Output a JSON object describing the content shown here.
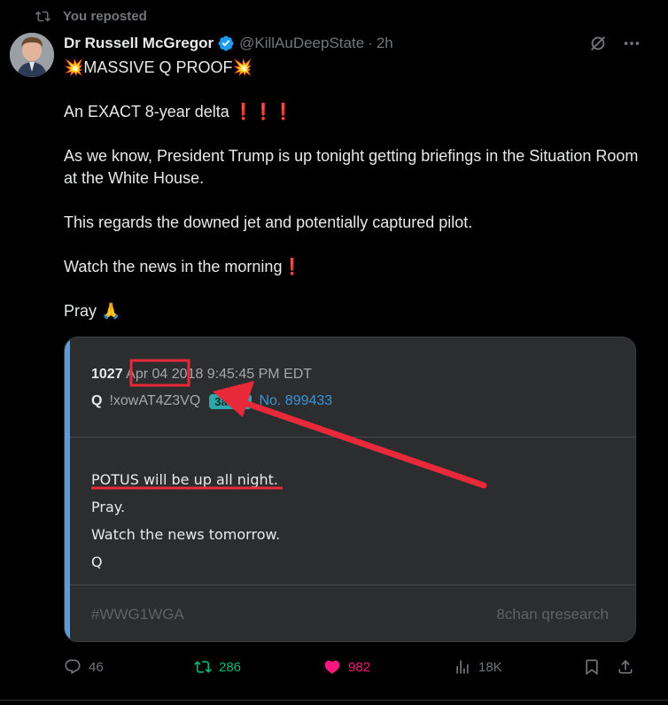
{
  "repost_label": "You reposted",
  "author": {
    "display_name": "Dr Russell McGregor",
    "handle": "@KillAuDeepState",
    "separator": "·",
    "time": "2h"
  },
  "tweet": {
    "headline_prefix": "💥",
    "headline": "MASSIVE Q PROOF",
    "headline_suffix": "💥",
    "line2": "An EXACT 8-year delta",
    "line2_marks": "❗❗❗",
    "line3": "As we know, President Trump is up tonight getting briefings in the Situation Room at the White House.",
    "line4": "This regards the downed jet and potentially captured pilot.",
    "line5": "Watch the news in the morning",
    "line5_mark": "❗",
    "line6": "Pray",
    "line6_emoji": "🙏"
  },
  "embed": {
    "post_number": "1027",
    "date": "Apr 04",
    "datetime_rest": "2018 9:45:45 PM EDT",
    "q_label": "Q",
    "tripcode": "!xowAT4Z3VQ",
    "id_tag": "3a3aa",
    "post_no": "No. 899433",
    "body": [
      "POTUS will be up all night.",
      "Pray.",
      "Watch the news tomorrow.",
      "Q"
    ],
    "hashtag": "#WWG1WGA",
    "board": "8chan qresearch"
  },
  "actions": {
    "replies": "46",
    "reposts": "286",
    "likes": "982",
    "views": "18K"
  },
  "colors": {
    "accent_repost": "#00ba7c",
    "accent_like": "#f91880",
    "annotation_red": "#e8293a",
    "link_blue": "#3a94d6",
    "verified_blue": "#1d9bf0"
  },
  "icons": [
    "repost-icon",
    "verified-badge-icon",
    "grok-icon",
    "more-icon",
    "reply-icon",
    "repost-action-icon",
    "like-icon",
    "views-icon",
    "bookmark-icon",
    "share-icon"
  ]
}
